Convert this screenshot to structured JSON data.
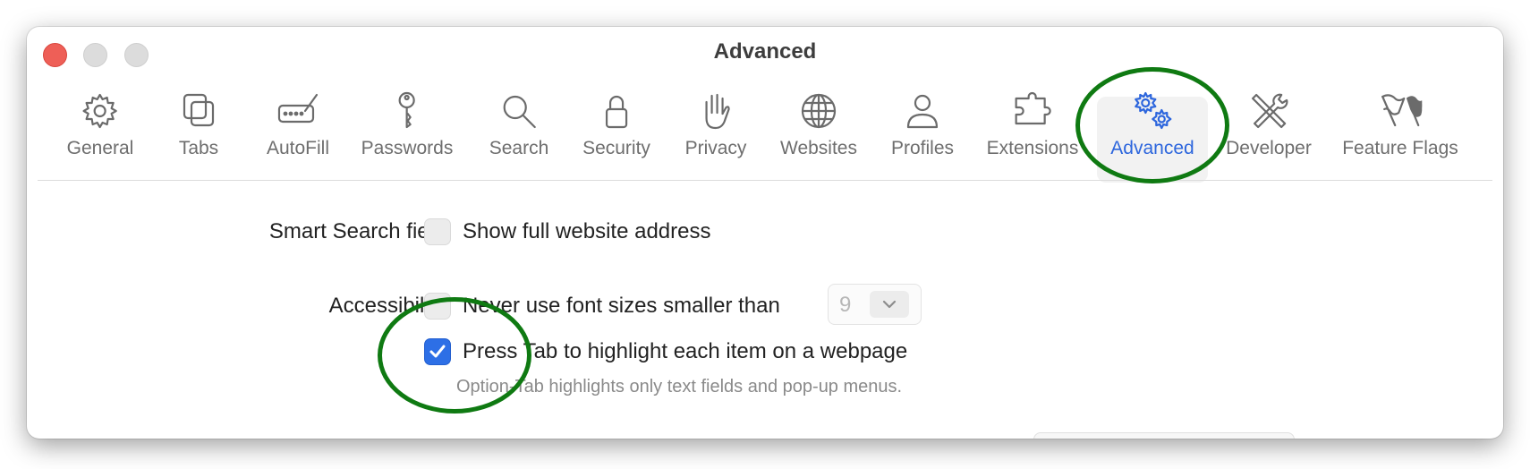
{
  "window": {
    "title": "Advanced"
  },
  "toolbar": {
    "tabs": [
      {
        "label": "General",
        "icon": "gear-icon"
      },
      {
        "label": "Tabs",
        "icon": "tabs-icon"
      },
      {
        "label": "AutoFill",
        "icon": "autofill-icon"
      },
      {
        "label": "Passwords",
        "icon": "key-icon"
      },
      {
        "label": "Search",
        "icon": "search-icon"
      },
      {
        "label": "Security",
        "icon": "lock-icon"
      },
      {
        "label": "Privacy",
        "icon": "hand-icon"
      },
      {
        "label": "Websites",
        "icon": "globe-icon"
      },
      {
        "label": "Profiles",
        "icon": "person-icon"
      },
      {
        "label": "Extensions",
        "icon": "puzzle-icon"
      },
      {
        "label": "Advanced",
        "icon": "gears-icon",
        "selected": true
      },
      {
        "label": "Developer",
        "icon": "tools-icon"
      },
      {
        "label": "Feature Flags",
        "icon": "flags-icon"
      }
    ]
  },
  "settings": {
    "smart_search": {
      "label": "Smart Search field:",
      "option": "Show full website address",
      "checked": false
    },
    "accessibility": {
      "label": "Accessibility:",
      "min_font_option": "Never use font sizes smaller than",
      "min_font_checked": false,
      "min_font_value": "9",
      "press_tab_option": "Press Tab to highlight each item on a webpage",
      "press_tab_checked": true,
      "hint": "Option-Tab highlights only text fields and pop-up menus."
    }
  },
  "colors": {
    "accent": "#2d66dd",
    "annotation": "#0f7a12",
    "close_button": "#ee5f57"
  }
}
